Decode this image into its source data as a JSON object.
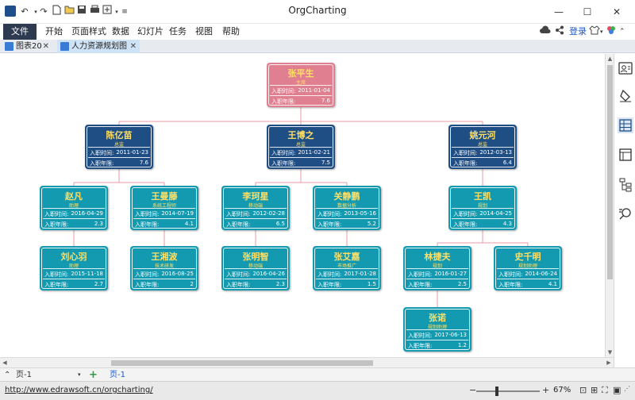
{
  "window": {
    "title": "OrgCharting"
  },
  "menu": {
    "file": "文件",
    "items": [
      "开始",
      "页面样式",
      "数据",
      "幻灯片",
      "任务",
      "视图",
      "帮助"
    ],
    "login": "登录"
  },
  "tabs": [
    {
      "label": "图表20"
    },
    {
      "label": "人力资源规划图"
    }
  ],
  "field_labels": {
    "hire_date": "入职时间:",
    "years": "入职年限:"
  },
  "colors": {
    "root": "#e07f8f",
    "executive": "#1f4e85",
    "staff": "#139ab0",
    "connector": "#e89aa4"
  },
  "org": {
    "root": {
      "name": "张平生",
      "role": "主席",
      "date": "2011-01-04",
      "years": "7.6"
    },
    "executives": [
      {
        "name": "陈亿苗",
        "role": "总监",
        "date": "2011-01-23",
        "years": "7.6"
      },
      {
        "name": "王博之",
        "role": "总监",
        "date": "2011-02-21",
        "years": "7.5"
      },
      {
        "name": "姚元河",
        "role": "总监",
        "date": "2012-03-13",
        "years": "6.4"
      }
    ],
    "staff": [
      {
        "name": "赵凡",
        "role": "助理",
        "date": "2016-04-29",
        "years": "2.3"
      },
      {
        "name": "王曼藤",
        "role": "系统工程师",
        "date": "2014-07-19",
        "years": "4.1"
      },
      {
        "name": "李珂星",
        "role": "移动端",
        "date": "2012-02-28",
        "years": "6.5"
      },
      {
        "name": "关静鹏",
        "role": "数据分析",
        "date": "2013-05-16",
        "years": "5.2"
      },
      {
        "name": "王凯",
        "role": "规划",
        "date": "2014-04-25",
        "years": "4.3"
      },
      {
        "name": "刘心羽",
        "role": "助理",
        "date": "2015-11-18",
        "years": "2.7"
      },
      {
        "name": "王湘波",
        "role": "技术研发",
        "date": "2016-08-25",
        "years": "2"
      },
      {
        "name": "张明智",
        "role": "移动端",
        "date": "2016-04-26",
        "years": "2.3"
      },
      {
        "name": "张艾嘉",
        "role": "市场推广",
        "date": "2017-01-28",
        "years": "1.5"
      },
      {
        "name": "林捷夫",
        "role": "规划",
        "date": "2016-01-27",
        "years": "2.5"
      },
      {
        "name": "史千明",
        "role": "规划助理",
        "date": "2014-06-24",
        "years": "4.1"
      },
      {
        "name": "张诺",
        "role": "规划助理",
        "date": "2017-06-13",
        "years": "1.2"
      }
    ]
  },
  "pagebar": {
    "page_select": "页-1",
    "page_tab": "页-1"
  },
  "status": {
    "url": "http://www.edrawsoft.cn/orgcharting/",
    "zoom": "67%"
  }
}
